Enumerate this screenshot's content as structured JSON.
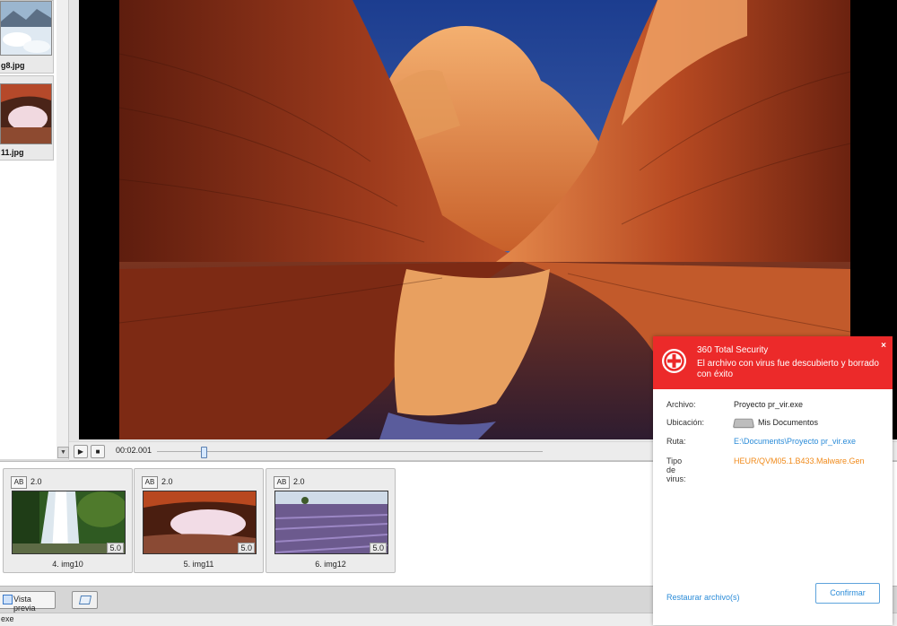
{
  "thumbnails": [
    {
      "filename": "g8.jpg"
    },
    {
      "filename": "11.jpg"
    }
  ],
  "playback": {
    "timecode": "00:02.001",
    "play_icon": "play-icon",
    "stop_icon": "stop-icon",
    "progress": 0.12
  },
  "clips": [
    {
      "ab": "AB",
      "duration": "2.0",
      "clip_duration": "5.0",
      "name": "4. img10"
    },
    {
      "ab": "AB",
      "duration": "2.0",
      "clip_duration": "5.0",
      "name": "5. img11"
    },
    {
      "ab": "AB",
      "duration": "2.0",
      "clip_duration": "5.0",
      "name": "6. img12"
    }
  ],
  "toolbar": {
    "preview_label": "Vista previa"
  },
  "status": {
    "text": "exe"
  },
  "av_popup": {
    "title": "360 Total Security",
    "message": "El archivo con virus fue descubierto y borrado con éxito",
    "close": "×",
    "rows": {
      "file": {
        "label": "Archivo:",
        "value": "Proyecto pr_vir.exe"
      },
      "location": {
        "label": "Ubicación:",
        "value": "Mis Documentos"
      },
      "path": {
        "label": "Ruta:",
        "value": "E:\\Documents\\Proyecto pr_vir.exe"
      },
      "virus": {
        "label": "Tipo de virus:",
        "value": "HEUR/QVM05.1.B433.Malware.Gen"
      }
    },
    "restore_label": "Restaurar archivo(s)",
    "confirm_label": "Confirmar",
    "colors": {
      "header": "#ec2a2a",
      "link": "#2a8bd8",
      "warning": "#f08a1a"
    }
  }
}
